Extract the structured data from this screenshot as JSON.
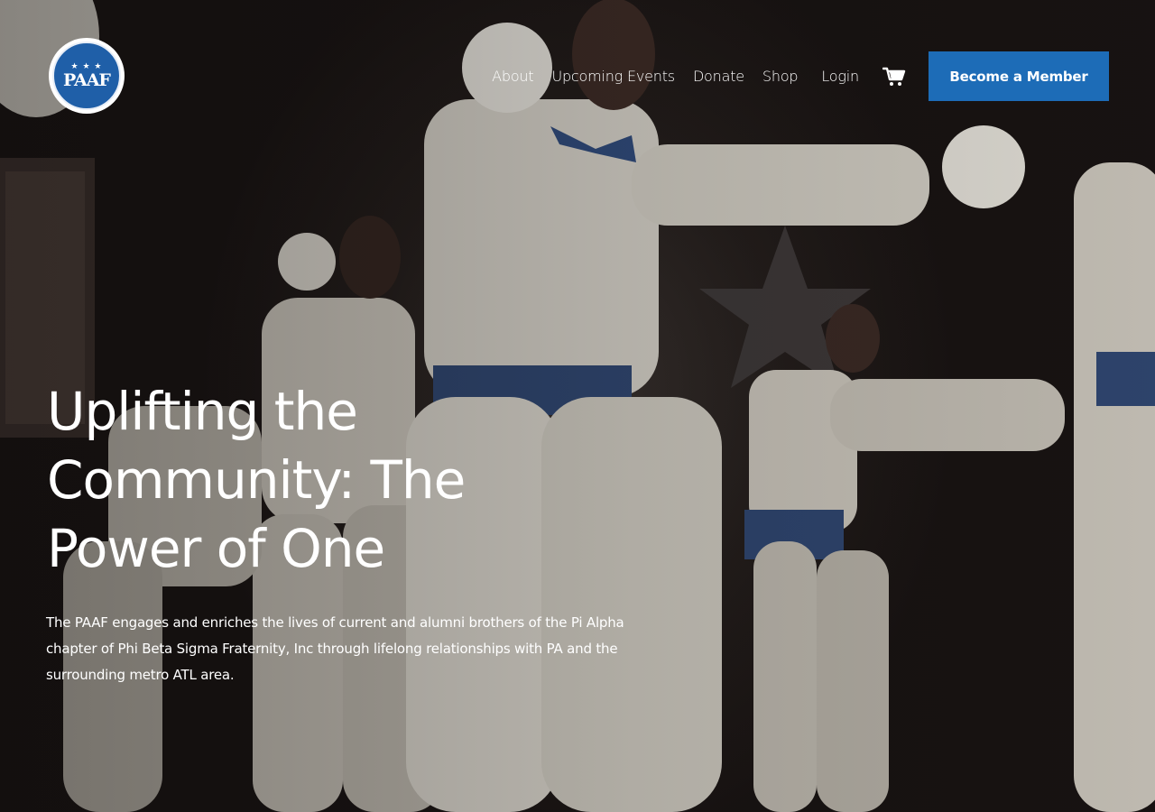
{
  "brand": {
    "logo_text": "PAAF",
    "logo_stars": "★ ★ ★"
  },
  "nav": {
    "items": [
      {
        "label": "About"
      },
      {
        "label": "Upcoming Events"
      },
      {
        "label": "Donate"
      },
      {
        "label": "Shop"
      },
      {
        "label": "Login"
      }
    ],
    "cart_icon": "shopping-cart-icon",
    "cta_label": "Become a Member"
  },
  "hero": {
    "headline": "Uplifting the Community: The Power of One",
    "description": "The PAAF engages and enriches the lives of current and alumni brothers of the Pi Alpha chapter of Phi Beta Sigma Fraternity, Inc through lifelong relationships with PA and the surrounding metro ATL area."
  },
  "colors": {
    "accent": "#1d6cb7",
    "text": "#ffffff"
  }
}
